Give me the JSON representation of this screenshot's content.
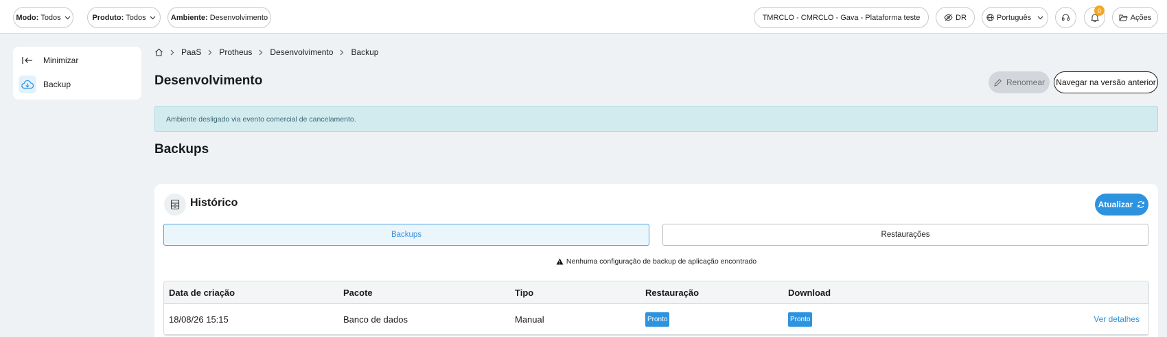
{
  "topbar": {
    "modo": {
      "label": "Modo:",
      "value": "Todos"
    },
    "produto": {
      "label": "Produto:",
      "value": "Todos"
    },
    "ambiente": {
      "label": "Ambiente:",
      "value": "Desenvolvimento"
    },
    "tenant": "TMRCLO - CMRCLO - Gava - Plataforma teste",
    "dr": "DR",
    "language": "Português",
    "notifications_count": "0",
    "actions": "Ações"
  },
  "sidebar": {
    "items": [
      {
        "label": "Minimizar",
        "icon": "collapse-left-icon"
      },
      {
        "label": "Backup",
        "icon": "cloud-download-icon"
      }
    ]
  },
  "breadcrumb": [
    "PaaS",
    "Protheus",
    "Desenvolvimento",
    "Backup"
  ],
  "page": {
    "title": "Desenvolvimento",
    "rename_label": "Renomear",
    "prev_version_label": "Navegar na versão anterior",
    "alert": "Ambiente desligado via evento comercial de cancelamento.",
    "section_title": "Backups"
  },
  "history": {
    "title": "Histórico",
    "refresh_label": "Atualizar",
    "tabs": [
      "Backups",
      "Restaurações"
    ],
    "warning": "Nenhuma configuração de backup de aplicação encontrado",
    "columns": [
      "Data de criação",
      "Pacote",
      "Tipo",
      "Restauração",
      "Download"
    ],
    "rows": [
      {
        "date": "18/08/26 15:15",
        "package": "Banco de dados",
        "type": "Manual",
        "restore": "Pronto",
        "download": "Pronto",
        "details": "Ver detalhes"
      }
    ]
  },
  "colors": {
    "accent": "#2e93df",
    "badge": "#f5a623",
    "alert_bg": "#d2ebef"
  }
}
